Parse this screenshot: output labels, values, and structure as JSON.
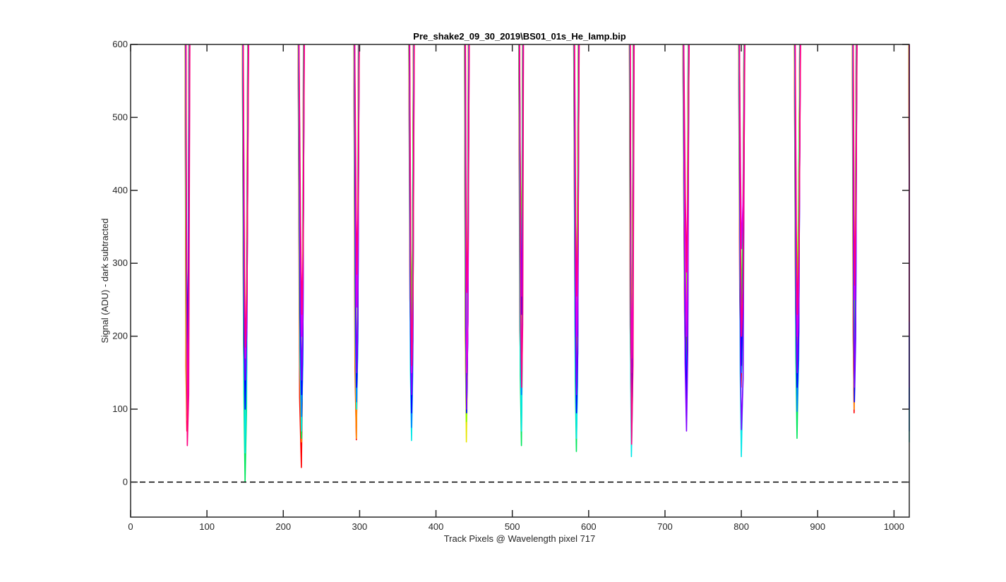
{
  "chart_data": {
    "type": "line",
    "title": "Pre_shake2_09_30_2019\\BS01_01s_He_lamp.bip",
    "xlabel": "Track Pixels @ Wavelength pixel 717",
    "ylabel": "Signal (ADU) - dark subtracted",
    "xlim": [
      0,
      1020
    ],
    "ylim": [
      -48,
      600
    ],
    "xticks": [
      0,
      100,
      200,
      300,
      400,
      500,
      600,
      700,
      800,
      900,
      1000
    ],
    "yticks": [
      0,
      100,
      200,
      300,
      400,
      500,
      600
    ],
    "grid": false,
    "legend": "none",
    "reference_line": {
      "y": 0,
      "style": "dashed",
      "color": "#000000"
    },
    "colors": [
      "#ff0000",
      "#ff8800",
      "#e6e600",
      "#7fff00",
      "#00e65c",
      "#00e6e6",
      "#0080ff",
      "#0000ff",
      "#8000ff",
      "#e600e6",
      "#ff0080"
    ],
    "series_note_colors_order": "red, orange, yellow, chartreuse, green, cyan, azure, blue, violet, magenta, rose",
    "peaks": [
      {
        "center": 74,
        "left": 72,
        "right": 77,
        "dips": [
          70,
          85,
          95,
          100,
          150,
          180,
          186,
          190,
          120,
          90,
          50
        ]
      },
      {
        "center": 150,
        "left": 147,
        "right": 154,
        "dips": [
          95,
          110,
          60,
          65,
          0,
          40,
          100,
          100,
          140,
          170,
          185
        ]
      },
      {
        "center": 224,
        "left": 220,
        "right": 227,
        "dips": [
          20,
          55,
          80,
          100,
          60,
          70,
          90,
          120,
          140,
          200,
          230
        ]
      },
      {
        "center": 296,
        "left": 293,
        "right": 299,
        "dips": [
          58,
          60,
          100,
          120,
          110,
          100,
          110,
          130,
          150,
          240,
          285
        ]
      },
      {
        "center": 368,
        "left": 365,
        "right": 371,
        "dips": [
          150,
          160,
          200,
          240,
          180,
          57,
          75,
          95,
          120,
          150,
          160
        ]
      },
      {
        "center": 440,
        "left": 438,
        "right": 443,
        "dips": [
          90,
          100,
          55,
          83,
          120,
          140,
          95,
          95,
          100,
          150,
          260
        ]
      },
      {
        "center": 512,
        "left": 509,
        "right": 514,
        "dips": [
          100,
          150,
          200,
          320,
          50,
          70,
          120,
          230,
          255,
          150,
          130
        ]
      },
      {
        "center": 584,
        "left": 581,
        "right": 587,
        "dips": [
          150,
          130,
          200,
          250,
          42,
          60,
          100,
          95,
          120,
          200,
          255
        ]
      },
      {
        "center": 656,
        "left": 654,
        "right": 659,
        "dips": [
          100,
          110,
          150,
          200,
          80,
          35,
          105,
          105,
          150,
          170,
          52
        ]
      },
      {
        "center": 728,
        "left": 724,
        "right": 731,
        "dips": [
          150,
          110,
          200,
          250,
          130,
          90,
          120,
          100,
          70,
          200,
          288
        ]
      },
      {
        "center": 800,
        "left": 797,
        "right": 804,
        "dips": [
          130,
          150,
          180,
          250,
          200,
          35,
          150,
          160,
          72,
          320,
          200
        ]
      },
      {
        "center": 873,
        "left": 870,
        "right": 877,
        "dips": [
          140,
          150,
          230,
          260,
          60,
          110,
          97,
          130,
          150,
          200,
          230
        ]
      },
      {
        "center": 948,
        "left": 946,
        "right": 951,
        "dips": [
          95,
          100,
          150,
          200,
          160,
          130,
          135,
          110,
          130,
          250,
          270
        ]
      },
      {
        "center": 1022,
        "left": 1020,
        "right": 1024,
        "dips": [
          220,
          200,
          180,
          150,
          120,
          55,
          70,
          100,
          130,
          200,
          220
        ]
      }
    ]
  }
}
